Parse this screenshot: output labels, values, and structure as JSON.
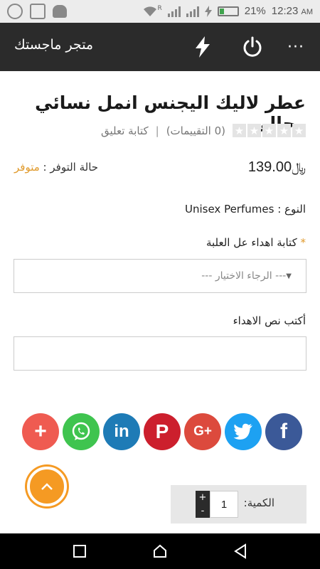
{
  "status_bar": {
    "battery_pct": "21%",
    "time": "12:23",
    "ampm": "AM",
    "roaming": "R"
  },
  "header": {
    "title": "متجر ماجستك",
    "more": "···"
  },
  "product": {
    "title": "عطر لاليك اليجنس انمل نسائي رجالي",
    "rating_count_text": "(0 التقييمات)",
    "separator": "|",
    "write_review": "كتابة تعليق",
    "price": "139.00",
    "currency": "﷼",
    "availability_label": "حالة التوفر :",
    "availability_value": "متوفر",
    "type_label": "النوع :",
    "type_value": "Unisex Perfumes"
  },
  "options": {
    "engrave_label": "كتابة اهداء عل العلبة",
    "required_mark": "*",
    "select_placeholder": "--- الرجاء الاختيار ---",
    "gift_text_label": "أكتب نص الاهداء"
  },
  "share": {
    "plus": "+",
    "linkedin": "in",
    "pinterest": "P",
    "googleplus": "G+",
    "facebook": "f"
  },
  "quantity": {
    "label": "الكمية:",
    "value": "1",
    "plus": "+",
    "minus": "-"
  },
  "colors": {
    "accent": "#f59a23",
    "header_bg": "#2b2b2b",
    "availability": "#e09a2c"
  }
}
